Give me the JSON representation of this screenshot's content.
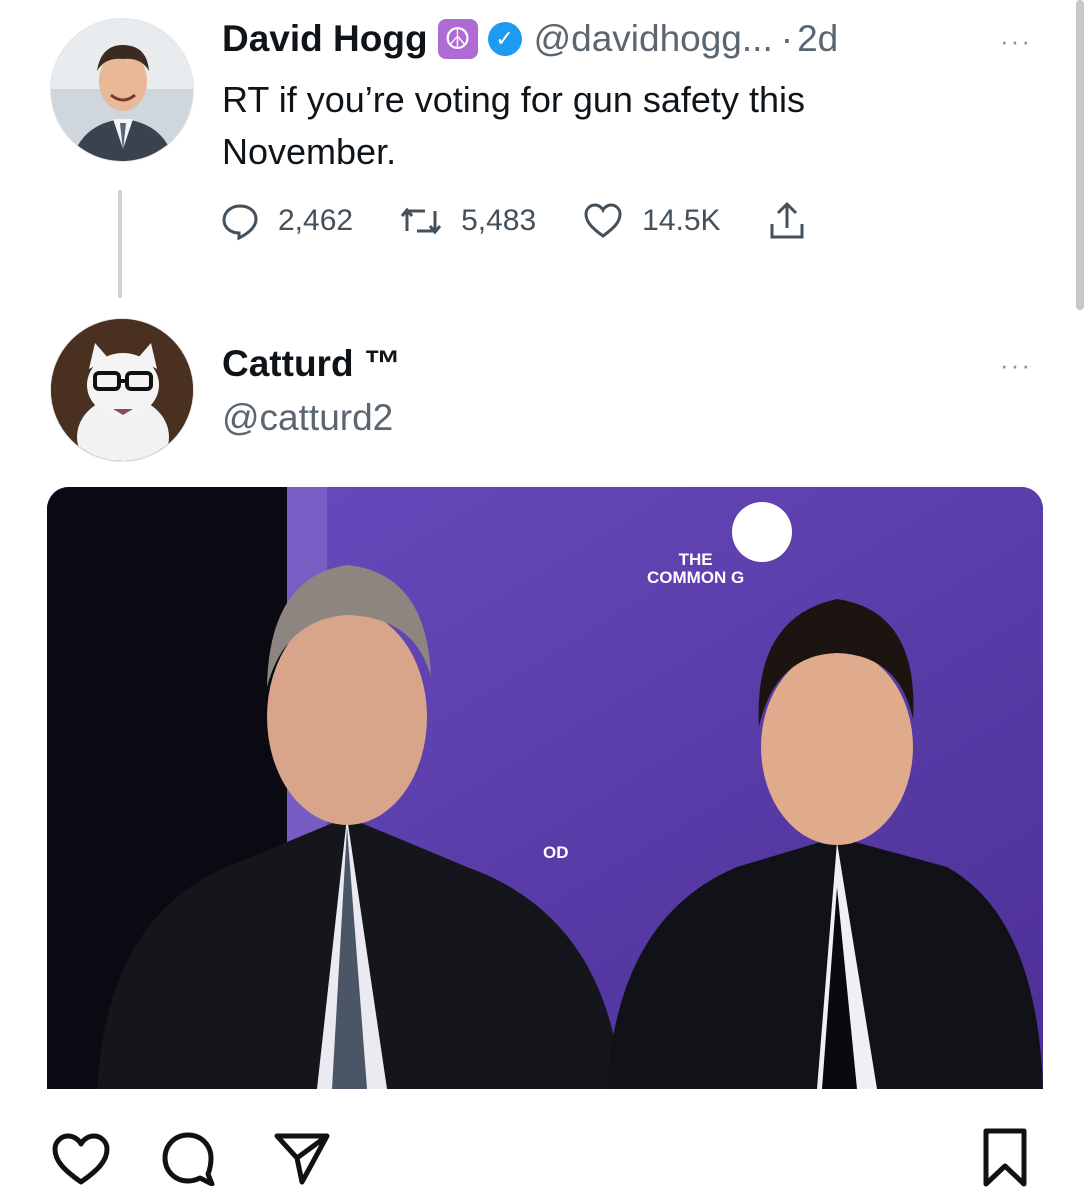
{
  "tweet1": {
    "author_name": "David Hogg",
    "badge_icon": "peace-sign-icon",
    "verified_icon": "verified-badge-icon",
    "handle": "@davidhogg...",
    "separator": "·",
    "time": "2d",
    "text_line1": "RT if you’re voting for gun safety this",
    "text_line2": "November.",
    "replies": "2,462",
    "retweets": "5,483",
    "likes": "14.5K",
    "more": "···"
  },
  "tweet2": {
    "author_name": "Catturd ™",
    "handle": "@catturd2",
    "more": "···",
    "photo_sign_text_line1": "THE",
    "photo_sign_text_line2": "COMMON G",
    "photo_sign_text_lower": "OD"
  },
  "post_actions": {
    "like_icon": "heart-icon",
    "comment_icon": "comment-icon",
    "share_icon": "send-icon",
    "save_icon": "bookmark-icon"
  },
  "colors": {
    "verified": "#1d9bf0",
    "peace_badge": "#b06ad4",
    "backdrop_purple": "#5a3ea8"
  }
}
